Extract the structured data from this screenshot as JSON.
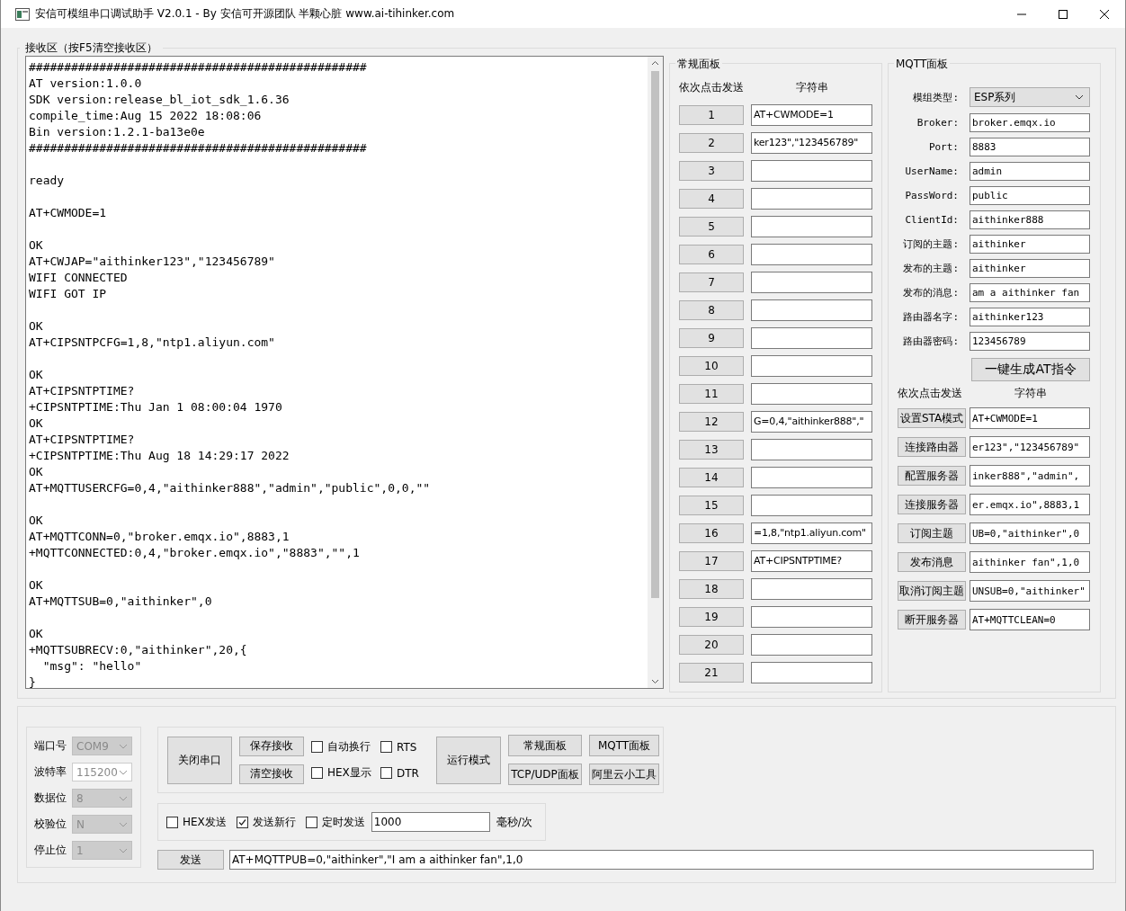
{
  "window": {
    "title": "安信可模组串口调试助手 V2.0.1 - By 安信可开源团队 半颗心脏 www.ai-tihinker.com"
  },
  "receive": {
    "title": "接收区（按F5清空接收区）",
    "text": "################################################\nAT version:1.0.0\nSDK version:release_bl_iot_sdk_1.6.36\ncompile_time:Aug 15 2022 18:08:06\nBin version:1.2.1-ba13e0e\n################################################\n\nready\n\nAT+CWMODE=1\n\nOK\nAT+CWJAP=\"aithinker123\",\"123456789\"\nWIFI CONNECTED\nWIFI GOT IP\n\nOK\nAT+CIPSNTPCFG=1,8,\"ntp1.aliyun.com\"\n\nOK\nAT+CIPSNTPTIME?\n+CIPSNTPTIME:Thu Jan 1 08:00:04 1970\nOK\nAT+CIPSNTPTIME?\n+CIPSNTPTIME:Thu Aug 18 14:29:17 2022\nOK\nAT+MQTTUSERCFG=0,4,\"aithinker888\",\"admin\",\"public\",0,0,\"\"\n\nOK\nAT+MQTTCONN=0,\"broker.emqx.io\",8883,1\n+MQTTCONNECTED:0,4,\"broker.emqx.io\",\"8883\",\"\",1\n\nOK\nAT+MQTTSUB=0,\"aithinker\",0\n\nOK\n+MQTTSUBRECV:0,\"aithinker\",20,{\n  \"msg\": \"hello\"\n}"
  },
  "regular_panel": {
    "title": "常规面板",
    "col_send": "依次点击发送",
    "col_string": "字符串",
    "rows": [
      {
        "button": "1",
        "value": "AT+CWMODE=1"
      },
      {
        "button": "2",
        "value": "ker123\",\"123456789\""
      },
      {
        "button": "3"
      },
      {
        "button": "4"
      },
      {
        "button": "5"
      },
      {
        "button": "6"
      },
      {
        "button": "7"
      },
      {
        "button": "8"
      },
      {
        "button": "9"
      },
      {
        "button": "10"
      },
      {
        "button": "11"
      },
      {
        "button": "12",
        "value": "G=0,4,\"aithinker888\",\""
      },
      {
        "button": "13"
      },
      {
        "button": "14"
      },
      {
        "button": "15"
      },
      {
        "button": "16",
        "value": "=1,8,\"ntp1.aliyun.com\""
      },
      {
        "button": "17",
        "value": "AT+CIPSNTPTIME?"
      },
      {
        "button": "18"
      },
      {
        "button": "19"
      },
      {
        "button": "20"
      },
      {
        "button": "21"
      }
    ]
  },
  "mqtt_panel": {
    "title": "MQTT面板",
    "module_type": {
      "label": "模组类型:",
      "value": "ESP系列"
    },
    "fields": [
      {
        "label": "Broker:",
        "value": "broker.emqx.io"
      },
      {
        "label": "Port:",
        "value": "8883"
      },
      {
        "label": "UserName:",
        "value": "admin"
      },
      {
        "label": "PassWord:",
        "value": "public"
      },
      {
        "label": "ClientId:",
        "value": "aithinker888"
      },
      {
        "label": "订阅的主题:",
        "value": "aithinker"
      },
      {
        "label": "发布的主题:",
        "value": "aithinker"
      },
      {
        "label": "发布的消息:",
        "value": "am a aithinker fan"
      },
      {
        "label": "路由器名字:",
        "value": "aithinker123"
      },
      {
        "label": "路由器密码:",
        "value": "123456789"
      }
    ],
    "generate_button": "一键生成AT指令",
    "col_send": "依次点击发送",
    "col_string": "字符串",
    "rows": [
      {
        "button": "设置STA模式",
        "value": "AT+CWMODE=1"
      },
      {
        "button": "连接路由器",
        "value": "er123\",\"123456789\""
      },
      {
        "button": "配置服务器",
        "value": "inker888\",\"admin\","
      },
      {
        "button": "连接服务器",
        "value": "er.emqx.io\",8883,1"
      },
      {
        "button": "订阅主题",
        "value": "UB=0,\"aithinker\",0"
      },
      {
        "button": "发布消息",
        "value": "aithinker fan\",1,0"
      },
      {
        "button": "取消订阅主题",
        "value": "UNSUB=0,\"aithinker\""
      },
      {
        "button": "断开服务器",
        "value": "AT+MQTTCLEAN=0"
      }
    ]
  },
  "serial": [
    {
      "label": "端口号",
      "value": "COM9",
      "disabled": true
    },
    {
      "label": "波特率",
      "value": "115200",
      "disabled": false
    },
    {
      "label": "数据位",
      "value": "8",
      "disabled": true
    },
    {
      "label": "校验位",
      "value": "N",
      "disabled": true
    },
    {
      "label": "停止位",
      "value": "1",
      "disabled": true
    }
  ],
  "controls": {
    "close_port": "关闭串口",
    "save": "保存接收",
    "clear": "清空接收",
    "checks": [
      {
        "label": "自动换行",
        "checked": false
      },
      {
        "label": "RTS",
        "checked": false
      },
      {
        "label": "HEX显示",
        "checked": false
      },
      {
        "label": "DTR",
        "checked": false
      }
    ],
    "run_mode": "运行模式",
    "panel_buttons": [
      "常规面板",
      "MQTT面板",
      "TCP/UDP面板",
      "阿里云小工具"
    ]
  },
  "send_options": {
    "checks": [
      {
        "label": "HEX发送",
        "checked": false
      },
      {
        "label": "发送新行",
        "checked": true
      },
      {
        "label": "定时发送",
        "checked": false
      }
    ],
    "interval": "1000",
    "unit": "毫秒/次"
  },
  "send": {
    "button": "发送",
    "value": "AT+MQTTPUB=0,\"aithinker\",\"I am a aithinker fan\",1,0"
  }
}
